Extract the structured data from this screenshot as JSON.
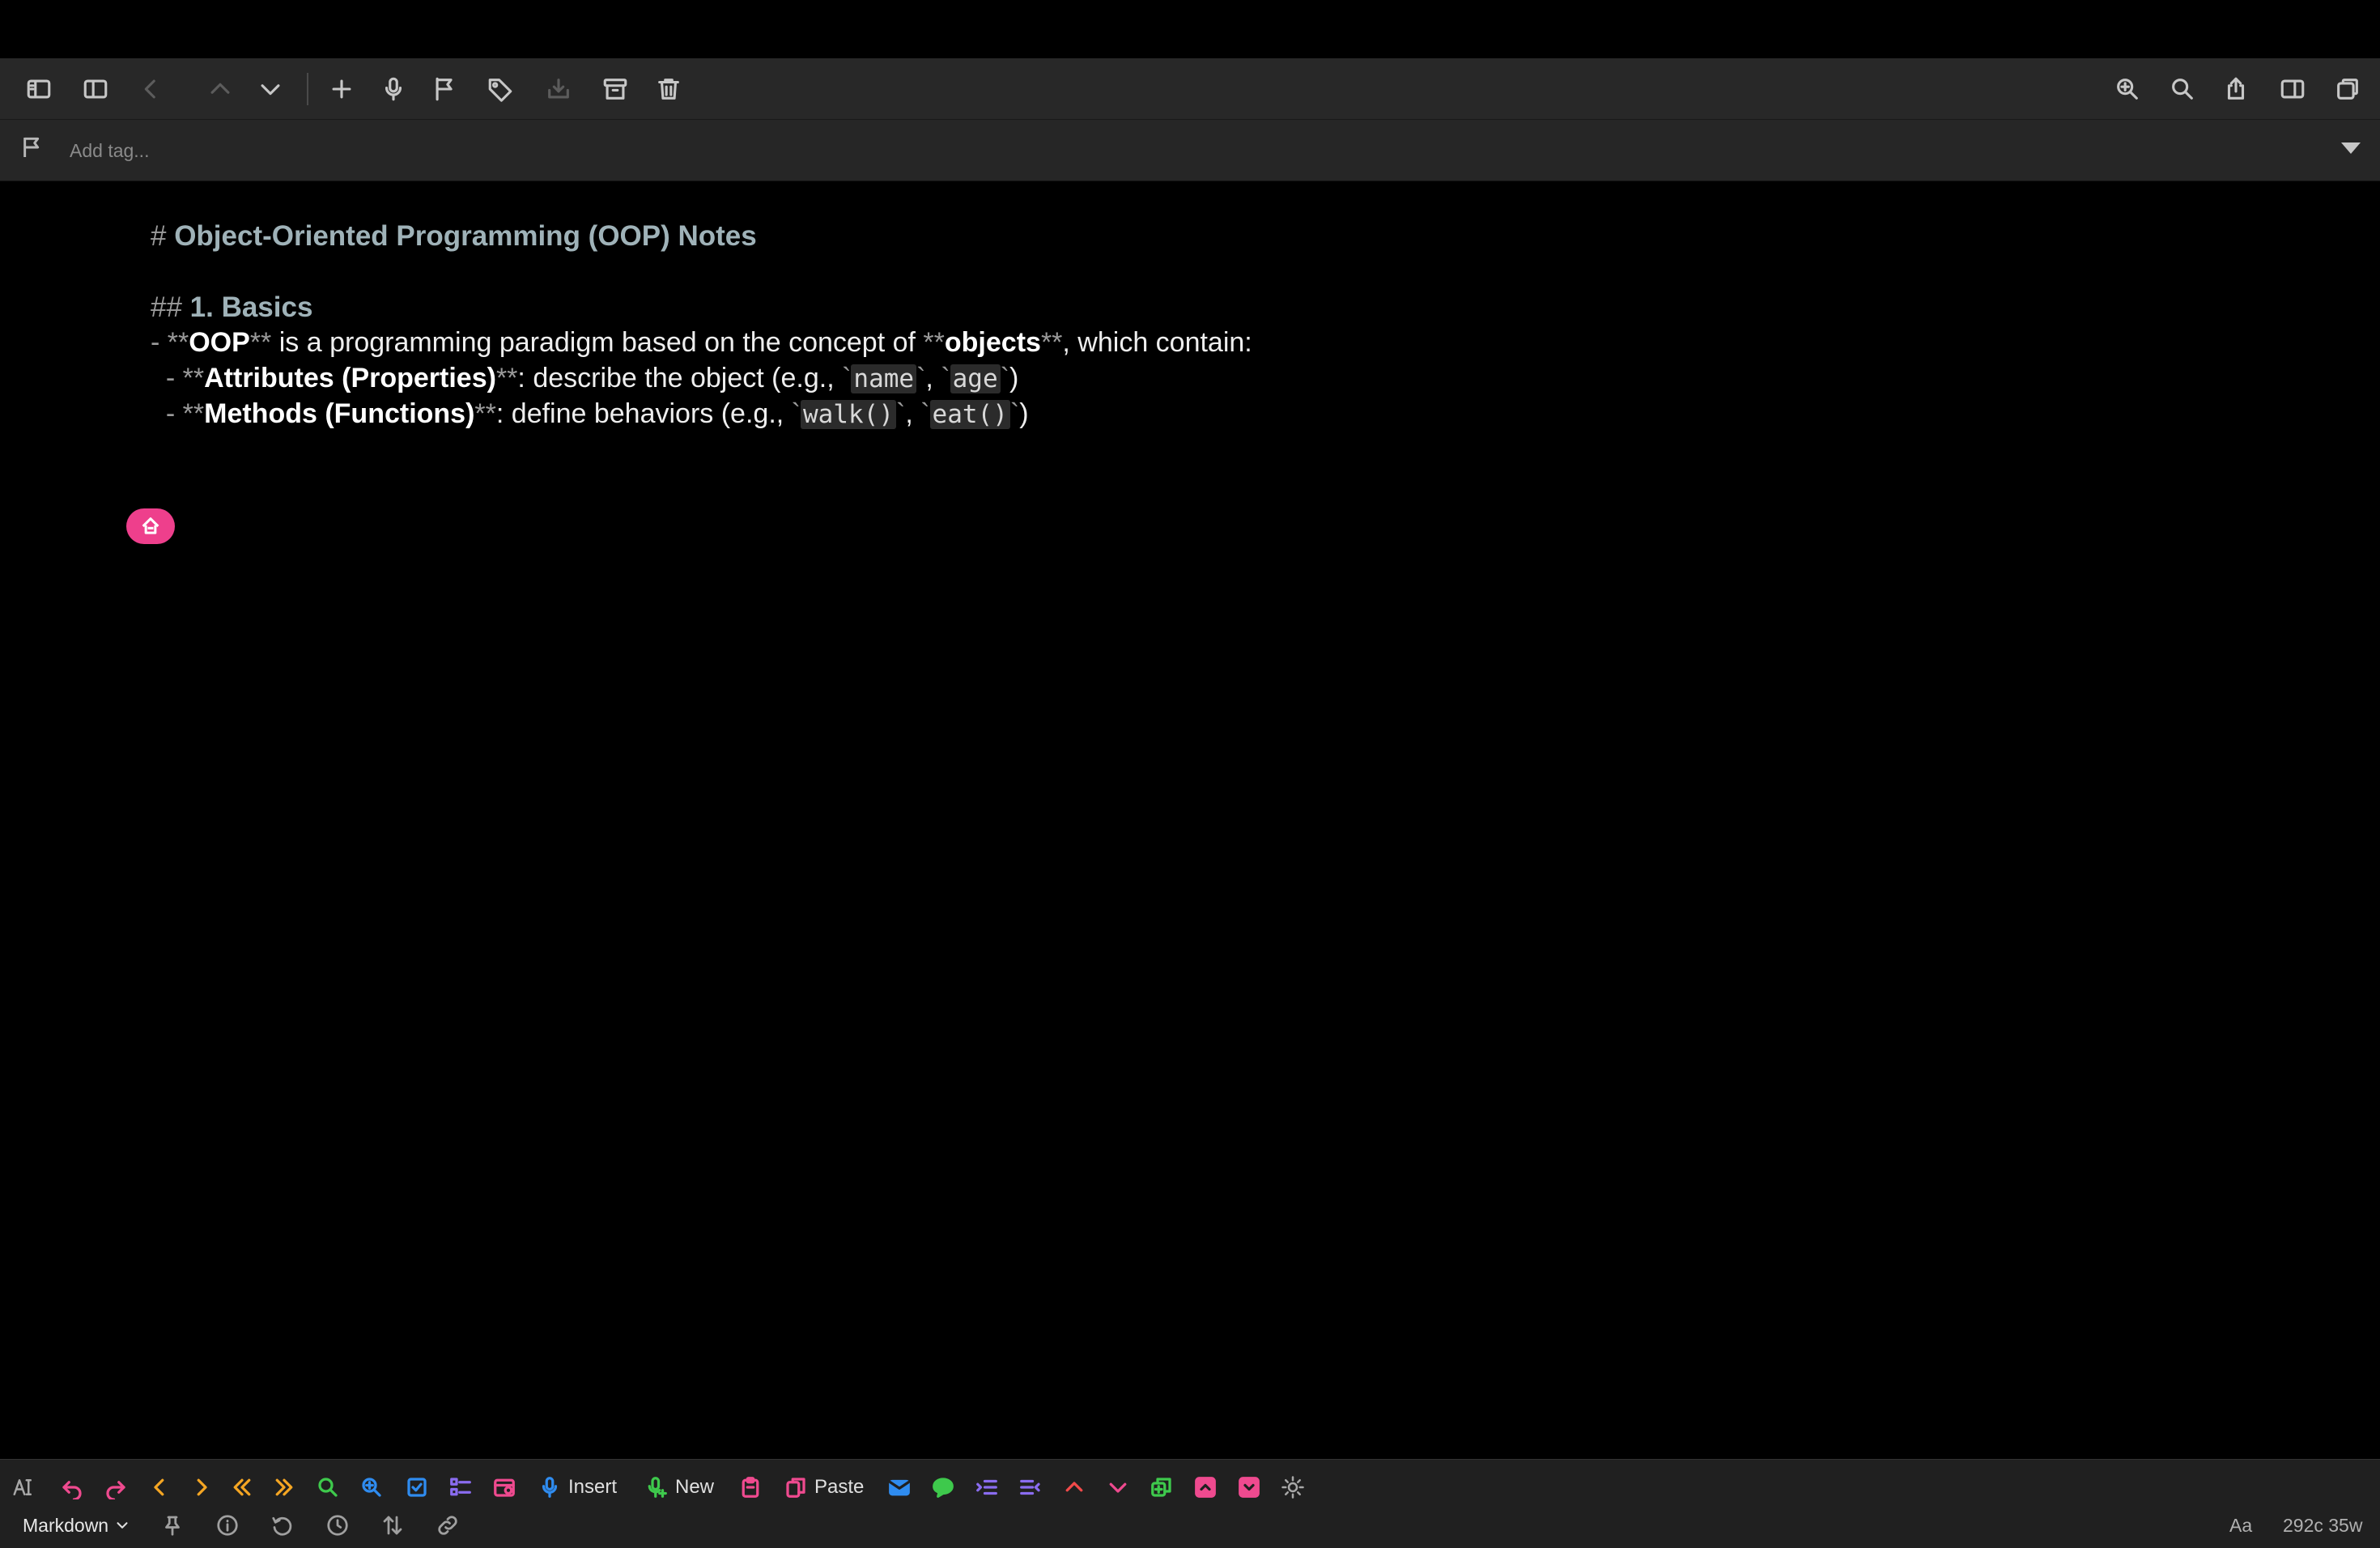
{
  "tagbar": {
    "placeholder": "Add tag..."
  },
  "note": {
    "h1_marker": "# ",
    "h1_text": "Object-Oriented Programming (OOP) Notes",
    "h2_marker": "## ",
    "h2_text": "1. Basics",
    "line1": {
      "prefix": "- **",
      "b1": "OOP",
      "m1": "**",
      "t1": " is a programming paradigm based on the concept of ",
      "m2": "**",
      "b2": "objects",
      "m3": "**",
      "t2": ", which contain:"
    },
    "line2": {
      "prefix": "  - **",
      "b1": "Attributes (Properties)",
      "m1": "**",
      "t1": ": describe the object (e.g., ",
      "tick1": "`",
      "code1": "name",
      "tick2": "`",
      "sep": ", ",
      "tick3": "`",
      "code2": "age",
      "tick4": "`",
      "close": ")"
    },
    "line3": {
      "prefix": "  - **",
      "b1": "Methods (Functions)",
      "m1": "**",
      "t1": ": define behaviors (e.g., ",
      "tick1": "`",
      "code1": "walk()",
      "tick2": "`",
      "sep": ", ",
      "tick3": "`",
      "code2": "eat()",
      "tick4": "`",
      "close": ")"
    }
  },
  "bottom_toolbar": {
    "insert_label": "Insert",
    "new_label": "New",
    "paste_label": "Paste"
  },
  "status_bar": {
    "mode": "Markdown",
    "font_label": "Aa",
    "counts": "292c 35w"
  },
  "icons": {
    "toolbar": [
      "sidebar-icon",
      "split-view-icon",
      "back-icon",
      "up-icon",
      "down-icon",
      "add-icon",
      "microphone-icon",
      "flag-icon",
      "tag-icon",
      "download-icon",
      "archive-icon",
      "trash-icon",
      "zoom-in-icon",
      "search-icon",
      "share-icon",
      "inspector-icon",
      "window-icon"
    ]
  },
  "colors": {
    "accent_pink": "#ee3f8c",
    "heading": "#9fb2b8"
  }
}
